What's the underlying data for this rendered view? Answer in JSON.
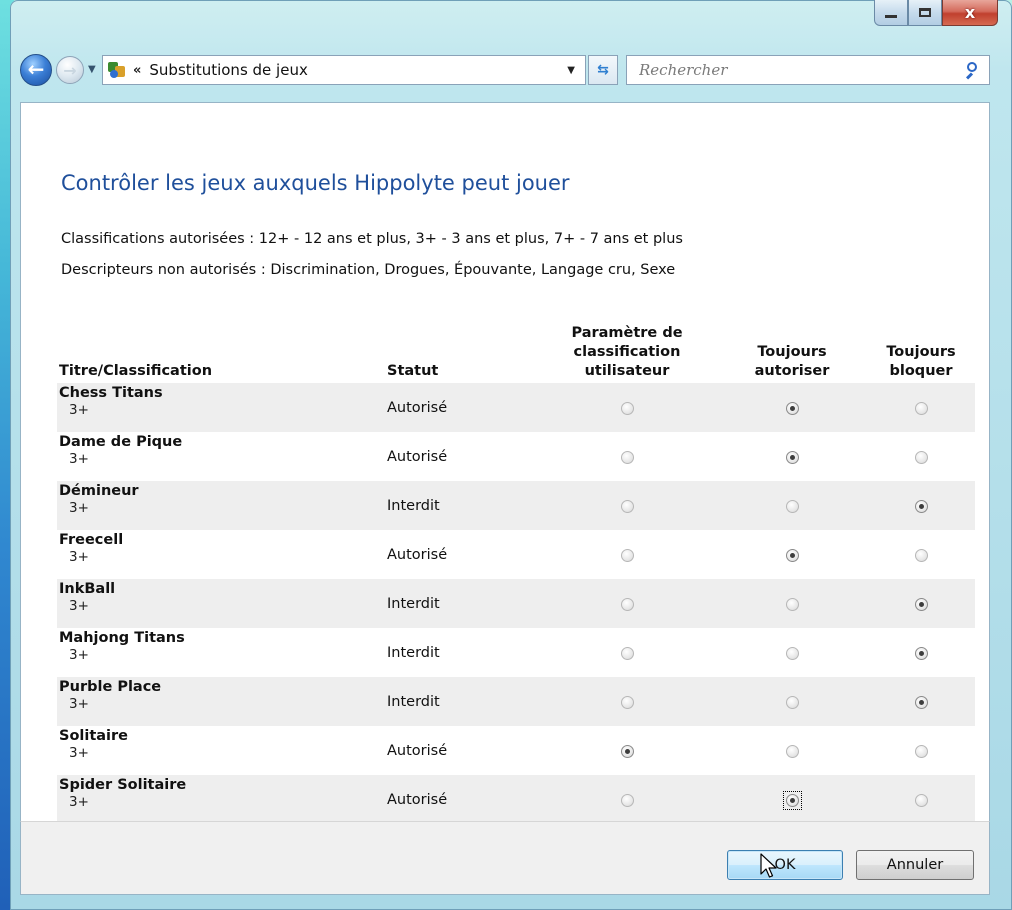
{
  "window": {
    "close_glyph": "x"
  },
  "nav": {
    "breadcrumb_chevrons": "«",
    "address": "Substitutions de jeux",
    "search_placeholder": "Rechercher"
  },
  "page": {
    "title": "Contrôler les jeux auxquels Hippolyte peut jouer",
    "allowed_ratings_label": "Classifications autorisées :",
    "allowed_ratings_value": "12+ - 12 ans et plus, 3+ - 3 ans et plus, 7+ - 7 ans et plus",
    "blocked_descriptors_label": "Descripteurs non autorisés :",
    "blocked_descriptors_value": "Discrimination, Drogues, Épouvante, Langage cru, Sexe"
  },
  "table": {
    "headers": {
      "title": "Titre/Classification",
      "status": "Statut",
      "user_rating_line1": "Paramètre de",
      "user_rating_line2": "classification",
      "user_rating_line3": "utilisateur",
      "always_allow_line1": "Toujours",
      "always_allow_line2": "autoriser",
      "always_block_line1": "Toujours",
      "always_block_line2": "bloquer"
    },
    "rows": [
      {
        "name": "Chess Titans",
        "rating": "3+",
        "status": "Autorisé",
        "selected": "allow"
      },
      {
        "name": "Dame de Pique",
        "rating": "3+",
        "status": "Autorisé",
        "selected": "allow"
      },
      {
        "name": "Démineur",
        "rating": "3+",
        "status": "Interdit",
        "selected": "block"
      },
      {
        "name": "Freecell",
        "rating": "3+",
        "status": "Autorisé",
        "selected": "allow"
      },
      {
        "name": "InkBall",
        "rating": "3+",
        "status": "Interdit",
        "selected": "block"
      },
      {
        "name": "Mahjong Titans",
        "rating": "3+",
        "status": "Interdit",
        "selected": "block"
      },
      {
        "name": "Purble Place",
        "rating": "3+",
        "status": "Interdit",
        "selected": "block"
      },
      {
        "name": "Solitaire",
        "rating": "3+",
        "status": "Autorisé",
        "selected": "user"
      },
      {
        "name": "Spider Solitaire",
        "rating": "3+",
        "status": "Autorisé",
        "selected": "allow",
        "focused": true
      }
    ]
  },
  "footer": {
    "ok_label": "OK",
    "cancel_label": "Annuler"
  },
  "colors": {
    "title_blue": "#1f4f9b",
    "row_stripe": "#eeeeee"
  }
}
